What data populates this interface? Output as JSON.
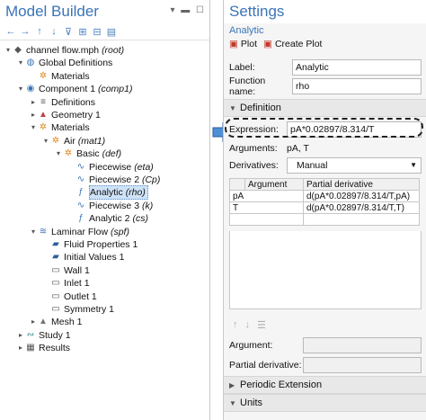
{
  "model_builder": {
    "title": "Model Builder",
    "toolbar_icons": [
      "arrow-left-icon",
      "arrow-right-icon",
      "arrow-up-icon",
      "arrow-down-icon",
      "filter-icon",
      "expand-icon",
      "collapse-icon",
      "view-icon"
    ],
    "tree": [
      {
        "text": "channel flow.mph",
        "em": "(root)",
        "level": 0,
        "tw": "▾",
        "icon": "file-icon"
      },
      {
        "text": "Global Definitions",
        "em": "",
        "level": 1,
        "tw": "▾",
        "icon": "globe-icon"
      },
      {
        "text": "Materials",
        "em": "",
        "level": 2,
        "tw": "",
        "icon": "materials-icon"
      },
      {
        "text": "Component 1",
        "em": "(comp1)",
        "level": 1,
        "tw": "▾",
        "icon": "component-icon"
      },
      {
        "text": "Definitions",
        "em": "",
        "level": 2,
        "tw": "▸",
        "icon": "definitions-icon"
      },
      {
        "text": "Geometry 1",
        "em": "",
        "level": 2,
        "tw": "▸",
        "icon": "geometry-icon"
      },
      {
        "text": "Materials",
        "em": "",
        "level": 2,
        "tw": "▾",
        "icon": "materials-icon"
      },
      {
        "text": "Air",
        "em": "(mat1)",
        "level": 3,
        "tw": "▾",
        "icon": "material-icon"
      },
      {
        "text": "Basic",
        "em": "(def)",
        "level": 4,
        "tw": "▾",
        "icon": "material-icon"
      },
      {
        "text": "Piecewise",
        "em": "(eta)",
        "level": 5,
        "tw": "",
        "icon": "function-icon"
      },
      {
        "text": "Piecewise 2",
        "em": "(Cp)",
        "level": 5,
        "tw": "",
        "icon": "function-icon"
      },
      {
        "text": "Analytic",
        "em": "(rho)",
        "level": 5,
        "tw": "",
        "icon": "analytic-icon",
        "selected": true
      },
      {
        "text": "Piecewise 3",
        "em": "(k)",
        "level": 5,
        "tw": "",
        "icon": "function-icon"
      },
      {
        "text": "Analytic 2",
        "em": "(cs)",
        "level": 5,
        "tw": "",
        "icon": "analytic-icon"
      },
      {
        "text": "Laminar Flow",
        "em": "(spf)",
        "level": 2,
        "tw": "▾",
        "icon": "flow-icon"
      },
      {
        "text": "Fluid Properties 1",
        "em": "",
        "level": 3,
        "tw": "",
        "icon": "fluid-icon"
      },
      {
        "text": "Initial Values 1",
        "em": "",
        "level": 3,
        "tw": "",
        "icon": "fluid-icon"
      },
      {
        "text": "Wall 1",
        "em": "",
        "level": 3,
        "tw": "",
        "icon": "boundary-icon"
      },
      {
        "text": "Inlet 1",
        "em": "",
        "level": 3,
        "tw": "",
        "icon": "boundary-icon"
      },
      {
        "text": "Outlet 1",
        "em": "",
        "level": 3,
        "tw": "",
        "icon": "boundary-icon"
      },
      {
        "text": "Symmetry 1",
        "em": "",
        "level": 3,
        "tw": "",
        "icon": "boundary-icon"
      },
      {
        "text": "Mesh 1",
        "em": "",
        "level": 2,
        "tw": "▸",
        "icon": "mesh-icon"
      },
      {
        "text": "Study 1",
        "em": "",
        "level": 1,
        "tw": "▸",
        "icon": "study-icon"
      },
      {
        "text": "Results",
        "em": "",
        "level": 1,
        "tw": "▸",
        "icon": "results-icon"
      }
    ]
  },
  "settings": {
    "title": "Settings",
    "subtitle": "Analytic",
    "plot_label": "Plot",
    "create_plot_label": "Create Plot",
    "label_caption": "Label:",
    "label_value": "Analytic",
    "function_name_caption": "Function name:",
    "function_name_value": "rho",
    "definition_header": "Definition",
    "expression_caption": "Expression:",
    "expression_value": "pA*0.02897/8.314/T",
    "arguments_caption": "Arguments:",
    "arguments_value": "pA, T",
    "derivatives_caption": "Derivatives:",
    "derivatives_value": "Manual",
    "table_headers": [
      "Argument",
      "Partial derivative"
    ],
    "table_rows": [
      [
        "pA",
        "d(pA*0.02897/8.314/T,pA)"
      ],
      [
        "T",
        "d(pA*0.02897/8.314/T,T)"
      ]
    ],
    "argument_caption": "Argument:",
    "partial_derivative_caption": "Partial derivative:",
    "periodic_header": "Periodic Extension",
    "units_header": "Units"
  }
}
